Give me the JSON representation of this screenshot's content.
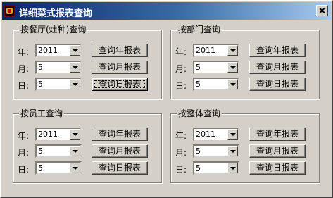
{
  "window": {
    "title": "详细菜式报表查询"
  },
  "groups": [
    {
      "legend": "按餐厅(灶种)查询",
      "year_label": "年:",
      "month_label": "月:",
      "day_label": "日:",
      "year": "2011",
      "month": "5",
      "day": "5",
      "btn_year": "查询年报表",
      "btn_month": "查询月报表",
      "btn_day": "查询日报表"
    },
    {
      "legend": "按部门查询",
      "year_label": "年:",
      "month_label": "月:",
      "day_label": "日:",
      "year": "2011",
      "month": "5",
      "day": "5",
      "btn_year": "查询年报表",
      "btn_month": "查询月报表",
      "btn_day": "查询日报表"
    },
    {
      "legend": "按员工查询",
      "year_label": "年:",
      "month_label": "月:",
      "day_label": "日:",
      "year": "2011",
      "month": "5",
      "day": "5",
      "btn_year": "查询年报表",
      "btn_month": "查询月报表",
      "btn_day": "查询日报表"
    },
    {
      "legend": "按整体查询",
      "year_label": "年:",
      "month_label": "月:",
      "day_label": "日:",
      "year": "2011",
      "month": "5",
      "day": "5",
      "btn_year": "查询年报表",
      "btn_month": "查询月报表",
      "btn_day": "查询日报表"
    }
  ]
}
